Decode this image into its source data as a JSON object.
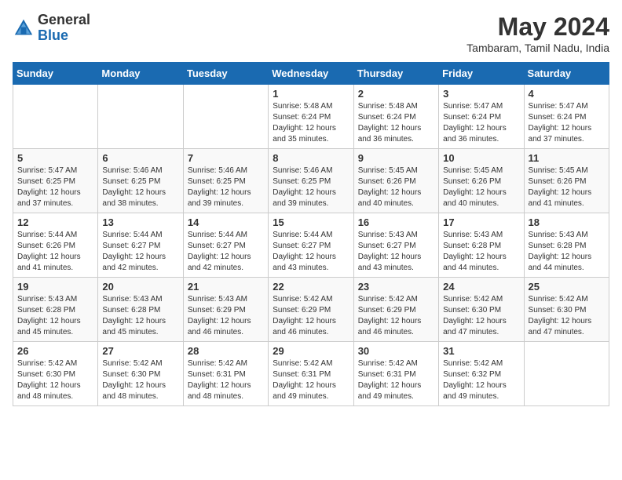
{
  "header": {
    "logo_general": "General",
    "logo_blue": "Blue",
    "month_title": "May 2024",
    "location": "Tambaram, Tamil Nadu, India"
  },
  "days_of_week": [
    "Sunday",
    "Monday",
    "Tuesday",
    "Wednesday",
    "Thursday",
    "Friday",
    "Saturday"
  ],
  "weeks": [
    [
      {
        "day": "",
        "sunrise": "",
        "sunset": "",
        "daylight": ""
      },
      {
        "day": "",
        "sunrise": "",
        "sunset": "",
        "daylight": ""
      },
      {
        "day": "",
        "sunrise": "",
        "sunset": "",
        "daylight": ""
      },
      {
        "day": "1",
        "sunrise": "Sunrise: 5:48 AM",
        "sunset": "Sunset: 6:24 PM",
        "daylight": "Daylight: 12 hours and 35 minutes."
      },
      {
        "day": "2",
        "sunrise": "Sunrise: 5:48 AM",
        "sunset": "Sunset: 6:24 PM",
        "daylight": "Daylight: 12 hours and 36 minutes."
      },
      {
        "day": "3",
        "sunrise": "Sunrise: 5:47 AM",
        "sunset": "Sunset: 6:24 PM",
        "daylight": "Daylight: 12 hours and 36 minutes."
      },
      {
        "day": "4",
        "sunrise": "Sunrise: 5:47 AM",
        "sunset": "Sunset: 6:24 PM",
        "daylight": "Daylight: 12 hours and 37 minutes."
      }
    ],
    [
      {
        "day": "5",
        "sunrise": "Sunrise: 5:47 AM",
        "sunset": "Sunset: 6:25 PM",
        "daylight": "Daylight: 12 hours and 37 minutes."
      },
      {
        "day": "6",
        "sunrise": "Sunrise: 5:46 AM",
        "sunset": "Sunset: 6:25 PM",
        "daylight": "Daylight: 12 hours and 38 minutes."
      },
      {
        "day": "7",
        "sunrise": "Sunrise: 5:46 AM",
        "sunset": "Sunset: 6:25 PM",
        "daylight": "Daylight: 12 hours and 39 minutes."
      },
      {
        "day": "8",
        "sunrise": "Sunrise: 5:46 AM",
        "sunset": "Sunset: 6:25 PM",
        "daylight": "Daylight: 12 hours and 39 minutes."
      },
      {
        "day": "9",
        "sunrise": "Sunrise: 5:45 AM",
        "sunset": "Sunset: 6:26 PM",
        "daylight": "Daylight: 12 hours and 40 minutes."
      },
      {
        "day": "10",
        "sunrise": "Sunrise: 5:45 AM",
        "sunset": "Sunset: 6:26 PM",
        "daylight": "Daylight: 12 hours and 40 minutes."
      },
      {
        "day": "11",
        "sunrise": "Sunrise: 5:45 AM",
        "sunset": "Sunset: 6:26 PM",
        "daylight": "Daylight: 12 hours and 41 minutes."
      }
    ],
    [
      {
        "day": "12",
        "sunrise": "Sunrise: 5:44 AM",
        "sunset": "Sunset: 6:26 PM",
        "daylight": "Daylight: 12 hours and 41 minutes."
      },
      {
        "day": "13",
        "sunrise": "Sunrise: 5:44 AM",
        "sunset": "Sunset: 6:27 PM",
        "daylight": "Daylight: 12 hours and 42 minutes."
      },
      {
        "day": "14",
        "sunrise": "Sunrise: 5:44 AM",
        "sunset": "Sunset: 6:27 PM",
        "daylight": "Daylight: 12 hours and 42 minutes."
      },
      {
        "day": "15",
        "sunrise": "Sunrise: 5:44 AM",
        "sunset": "Sunset: 6:27 PM",
        "daylight": "Daylight: 12 hours and 43 minutes."
      },
      {
        "day": "16",
        "sunrise": "Sunrise: 5:43 AM",
        "sunset": "Sunset: 6:27 PM",
        "daylight": "Daylight: 12 hours and 43 minutes."
      },
      {
        "day": "17",
        "sunrise": "Sunrise: 5:43 AM",
        "sunset": "Sunset: 6:28 PM",
        "daylight": "Daylight: 12 hours and 44 minutes."
      },
      {
        "day": "18",
        "sunrise": "Sunrise: 5:43 AM",
        "sunset": "Sunset: 6:28 PM",
        "daylight": "Daylight: 12 hours and 44 minutes."
      }
    ],
    [
      {
        "day": "19",
        "sunrise": "Sunrise: 5:43 AM",
        "sunset": "Sunset: 6:28 PM",
        "daylight": "Daylight: 12 hours and 45 minutes."
      },
      {
        "day": "20",
        "sunrise": "Sunrise: 5:43 AM",
        "sunset": "Sunset: 6:28 PM",
        "daylight": "Daylight: 12 hours and 45 minutes."
      },
      {
        "day": "21",
        "sunrise": "Sunrise: 5:43 AM",
        "sunset": "Sunset: 6:29 PM",
        "daylight": "Daylight: 12 hours and 46 minutes."
      },
      {
        "day": "22",
        "sunrise": "Sunrise: 5:42 AM",
        "sunset": "Sunset: 6:29 PM",
        "daylight": "Daylight: 12 hours and 46 minutes."
      },
      {
        "day": "23",
        "sunrise": "Sunrise: 5:42 AM",
        "sunset": "Sunset: 6:29 PM",
        "daylight": "Daylight: 12 hours and 46 minutes."
      },
      {
        "day": "24",
        "sunrise": "Sunrise: 5:42 AM",
        "sunset": "Sunset: 6:30 PM",
        "daylight": "Daylight: 12 hours and 47 minutes."
      },
      {
        "day": "25",
        "sunrise": "Sunrise: 5:42 AM",
        "sunset": "Sunset: 6:30 PM",
        "daylight": "Daylight: 12 hours and 47 minutes."
      }
    ],
    [
      {
        "day": "26",
        "sunrise": "Sunrise: 5:42 AM",
        "sunset": "Sunset: 6:30 PM",
        "daylight": "Daylight: 12 hours and 48 minutes."
      },
      {
        "day": "27",
        "sunrise": "Sunrise: 5:42 AM",
        "sunset": "Sunset: 6:30 PM",
        "daylight": "Daylight: 12 hours and 48 minutes."
      },
      {
        "day": "28",
        "sunrise": "Sunrise: 5:42 AM",
        "sunset": "Sunset: 6:31 PM",
        "daylight": "Daylight: 12 hours and 48 minutes."
      },
      {
        "day": "29",
        "sunrise": "Sunrise: 5:42 AM",
        "sunset": "Sunset: 6:31 PM",
        "daylight": "Daylight: 12 hours and 49 minutes."
      },
      {
        "day": "30",
        "sunrise": "Sunrise: 5:42 AM",
        "sunset": "Sunset: 6:31 PM",
        "daylight": "Daylight: 12 hours and 49 minutes."
      },
      {
        "day": "31",
        "sunrise": "Sunrise: 5:42 AM",
        "sunset": "Sunset: 6:32 PM",
        "daylight": "Daylight: 12 hours and 49 minutes."
      },
      {
        "day": "",
        "sunrise": "",
        "sunset": "",
        "daylight": ""
      }
    ]
  ]
}
